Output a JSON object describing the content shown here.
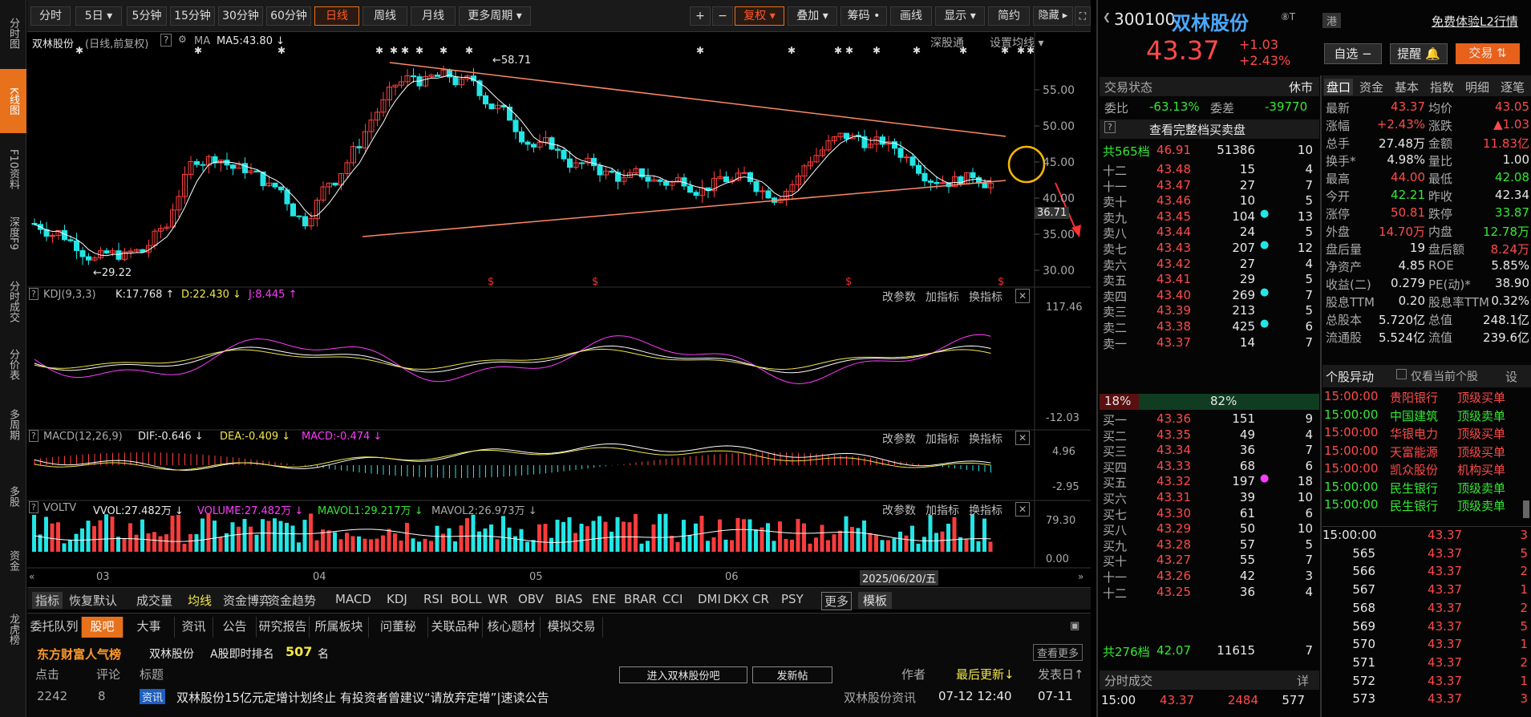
{
  "leftnav": [
    "分时图",
    "K线图",
    "F10资料",
    "深度F9",
    "分时成交",
    "分价表",
    "多周期",
    "多股",
    "资金",
    "龙虎榜"
  ],
  "toolbar": {
    "periods": [
      "分时",
      "5日 ▾",
      "5分钟",
      "15分钟",
      "30分钟",
      "60分钟",
      "日线",
      "周线",
      "月线",
      "更多周期 ▾"
    ],
    "right": [
      "+",
      "−",
      "复权 ▾",
      "叠加 ▾",
      "筹码 •",
      "画线",
      "显示 ▾",
      "简约",
      "隐藏 ▸"
    ]
  },
  "chart": {
    "title": "双林股份",
    "title_sub": "(日线,前复权)",
    "ma_label": "MA",
    "ma5": "MA5:43.80 ↓",
    "depth_btn": "深股通",
    "set_ma": "设置均线 ▾",
    "price_ticks": [
      "55.00",
      "50.00",
      "45.00",
      "40.00",
      "35.00",
      "30.00"
    ],
    "cur_price_tag": "36.71",
    "high_label": "←58.71",
    "low_label": "←29.22",
    "months": [
      "03",
      "04",
      "05",
      "06"
    ],
    "date_tag": "2025/06/20/五",
    "kdj": {
      "name": "KDJ(9,3,3)",
      "k": "K:17.768 ↑",
      "d": "D:22.430 ↓",
      "j": "J:8.445 ↑",
      "top": "117.46",
      "bottom": "-12.03"
    },
    "macd": {
      "name": "MACD(12,26,9)",
      "dif": "DIF:-0.646 ↓",
      "dea": "DEA:-0.409 ↓",
      "macd": "MACD:-0.474 ↓",
      "top": "4.96",
      "bottom": "-2.95"
    },
    "vol": {
      "name": "VOLTV",
      "vvol": "VVOL:27.482万 ↓",
      "volume": "VOLUME:27.482万 ↓",
      "mavol1": "MAVOL1:29.217万 ↓",
      "mavol2": "MAVOL2:26.973万 ↓",
      "top": "79.30",
      "bottom": "0.00"
    },
    "panel_btns": [
      "改参数",
      "加指标",
      "换指标"
    ]
  },
  "indicators": [
    "指标",
    "恢复默认",
    "成交量",
    "均线",
    "资金博弈",
    "资金趋势",
    "MACD",
    "KDJ",
    "RSI",
    "BOLL",
    "WR",
    "OBV",
    "BIAS",
    "ENE",
    "BRAR",
    "CCI",
    "DMI",
    "DKX",
    "CR",
    "PSY",
    "更多",
    "模板"
  ],
  "bottom": {
    "tabs": [
      "委托队列",
      "股吧",
      "大事",
      "资讯",
      "公告",
      "研究报告",
      "所属板块",
      "问董秘",
      "关联品种",
      "核心题材",
      "模拟交易"
    ],
    "rank_brand": "东方财富人气榜",
    "rank_stock": "双林股份",
    "rank_label": "A股即时排名",
    "rank_value": "507",
    "rank_unit": "名",
    "more": "查看更多",
    "cols": [
      "点击",
      "评论",
      "标题"
    ],
    "enter_btn": "进入双林股份吧",
    "post_btn": "发新帖",
    "author": "作者",
    "last_update": "最后更新↓",
    "post_date": "发表日↑",
    "rows": [
      {
        "clicks": "2242",
        "comments": "8",
        "tag": "资讯",
        "title": "双林股份15亿元定增计划终止 有投资者曾建议“请放弃定增”|速读公告",
        "author": "双林股份资讯",
        "updated": "07-12 12:40",
        "posted": "07-11"
      }
    ]
  },
  "quote": {
    "code": "300100",
    "name": "双林股份",
    "flag": "⑧T",
    "hk": "港",
    "l2": "免费体验L2行情",
    "price": "43.37",
    "change": "+1.03",
    "pct": "+2.43%",
    "btn_watch": "自选 −",
    "btn_alert": "提醒 🔔",
    "btn_trade": "交易 ⇅",
    "status_label": "交易状态",
    "status": "休市",
    "weibi_label": "委比",
    "weibi": "-63.13%",
    "weicha_label": "委差",
    "weicha": "-39770",
    "full_book": "查看完整档买卖盘",
    "sell_total": {
      "label": "共565档",
      "price": "46.91",
      "vol": "51386",
      "n": "10"
    },
    "sells": [
      [
        "十二",
        "43.48",
        "15",
        "4"
      ],
      [
        "十一",
        "43.47",
        "27",
        "7"
      ],
      [
        "卖十",
        "43.46",
        "10",
        "5"
      ],
      [
        "卖九",
        "43.45",
        "104",
        "13"
      ],
      [
        "卖八",
        "43.44",
        "24",
        "5"
      ],
      [
        "卖七",
        "43.43",
        "207",
        "12"
      ],
      [
        "卖六",
        "43.42",
        "27",
        "4"
      ],
      [
        "卖五",
        "43.41",
        "29",
        "5"
      ],
      [
        "卖四",
        "43.40",
        "269",
        "7"
      ],
      [
        "卖三",
        "43.39",
        "213",
        "5"
      ],
      [
        "卖二",
        "43.38",
        "425",
        "6"
      ],
      [
        "卖一",
        "43.37",
        "14",
        "7"
      ]
    ],
    "ratio_left": "18%",
    "ratio_right": "82%",
    "buys": [
      [
        "买一",
        "43.36",
        "151",
        "9"
      ],
      [
        "买二",
        "43.35",
        "49",
        "4"
      ],
      [
        "买三",
        "43.34",
        "36",
        "7"
      ],
      [
        "买四",
        "43.33",
        "68",
        "6"
      ],
      [
        "买五",
        "43.32",
        "197",
        "18"
      ],
      [
        "买六",
        "43.31",
        "39",
        "10"
      ],
      [
        "买七",
        "43.30",
        "61",
        "6"
      ],
      [
        "买八",
        "43.29",
        "50",
        "10"
      ],
      [
        "买九",
        "43.28",
        "57",
        "5"
      ],
      [
        "买十",
        "43.27",
        "55",
        "7"
      ],
      [
        "十一",
        "43.26",
        "42",
        "3"
      ],
      [
        "十二",
        "43.25",
        "36",
        "4"
      ]
    ],
    "buy_total": {
      "label": "共276档",
      "price": "42.07",
      "vol": "11615",
      "n": "7"
    },
    "ticks_title": "分时成交",
    "ticks_detail": "详",
    "tick_row": {
      "time": "15:00",
      "price": "43.37",
      "vol": "2484",
      "n": "577"
    }
  },
  "panel": {
    "tabs": [
      "盘口",
      "资金",
      "基本",
      "指数",
      "明细",
      "逐笔"
    ],
    "rows": [
      [
        "最新",
        "43.37",
        "均价",
        "43.05"
      ],
      [
        "涨幅",
        "+2.43%",
        "涨跌",
        "▲1.03"
      ],
      [
        "总手",
        "27.48万",
        "金额",
        "11.83亿"
      ],
      [
        "换手*",
        "4.98%",
        "量比",
        "1.00"
      ],
      [
        "最高",
        "44.00",
        "最低",
        "42.08"
      ],
      [
        "今开",
        "42.21",
        "昨收",
        "42.34"
      ],
      [
        "涨停",
        "50.81",
        "跌停",
        "33.87"
      ],
      [
        "外盘",
        "14.70万",
        "内盘",
        "12.78万"
      ],
      [
        "盘后量",
        "19",
        "盘后额",
        "8.24万"
      ],
      [
        "净资产",
        "4.85",
        "ROE",
        "5.85%"
      ],
      [
        "收益(二)",
        "0.279",
        "PE(动)*",
        "38.90"
      ],
      [
        "股息TTM",
        "0.20",
        "股息率TTM",
        "0.32%"
      ],
      [
        "总股本",
        "5.720亿",
        "总值",
        "248.1亿"
      ],
      [
        "流通股",
        "5.524亿",
        "流值",
        "239.6亿"
      ]
    ],
    "alert_title": "个股异动",
    "alert_check": "仅看当前个股",
    "alert_set": "设",
    "alerts": [
      [
        "15:00:00",
        "贵阳银行",
        "顶级买单"
      ],
      [
        "15:00:00",
        "中国建筑",
        "顶级卖单"
      ],
      [
        "15:00:00",
        "华银电力",
        "顶级买单"
      ],
      [
        "15:00:00",
        "天富能源",
        "顶级买单"
      ],
      [
        "15:00:00",
        "凯众股份",
        "机构买单"
      ],
      [
        "15:00:00",
        "民生银行",
        "顶级卖单"
      ],
      [
        "15:00:00",
        "民生银行",
        "顶级卖单"
      ]
    ],
    "trades": [
      [
        "15:00:00",
        "43.37",
        "3"
      ],
      [
        "565",
        "43.37",
        "5"
      ],
      [
        "566",
        "43.37",
        "2"
      ],
      [
        "567",
        "43.37",
        "1"
      ],
      [
        "568",
        "43.37",
        "2"
      ],
      [
        "569",
        "43.37",
        "5"
      ],
      [
        "570",
        "43.37",
        "1"
      ],
      [
        "571",
        "43.37",
        "2"
      ],
      [
        "572",
        "43.37",
        "1"
      ],
      [
        "573",
        "43.37",
        "3"
      ]
    ]
  },
  "colors": {
    "up": "#ff4040",
    "down": "#22e6e6",
    "accent": "#e8711b",
    "ma5": "#ffffff",
    "trend": "#ff8866"
  }
}
